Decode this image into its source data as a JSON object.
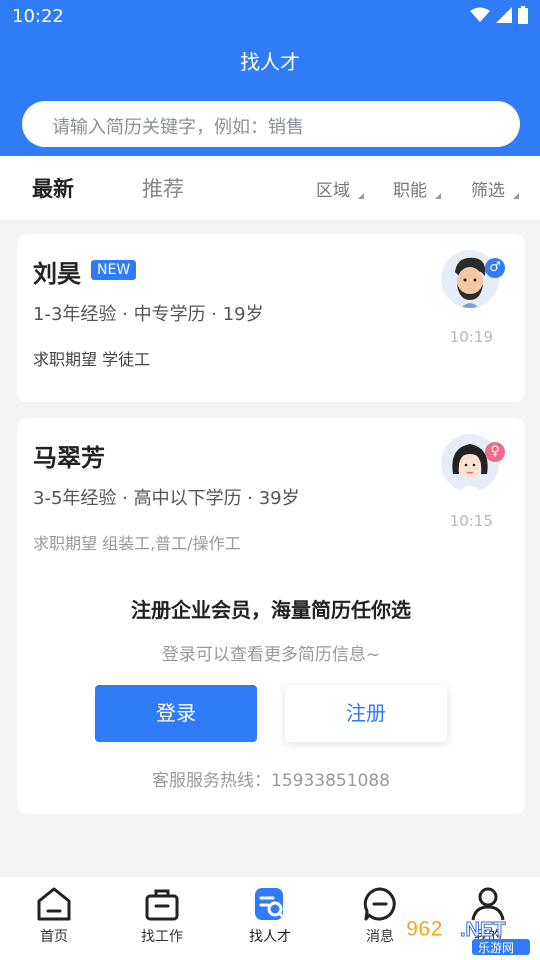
{
  "status": {
    "time": "10:22"
  },
  "header": {
    "title": "找人才"
  },
  "search": {
    "placeholder": "请输入简历关键字，例如：销售"
  },
  "tabs": {
    "latest": "最新",
    "recommend": "推荐"
  },
  "filters": {
    "area": "区域",
    "function": "职能",
    "filter": "筛选"
  },
  "cards": [
    {
      "name": "刘昊",
      "badge": "NEW",
      "info": "1-3年经验 · 中专学历 · 19岁",
      "expect": "求职期望 学徒工",
      "time": "10:19",
      "gender": "♂",
      "gender_color": "#2f7cf6"
    },
    {
      "name": "马翠芳",
      "info": "3-5年经验 · 高中以下学历 · 39岁",
      "expect": "求职期望 组装工,普工/操作工",
      "time": "10:15",
      "gender": "♀",
      "gender_color": "#f06b8c"
    }
  ],
  "promo": {
    "title": "注册企业会员，海量简历任你选",
    "subtitle": "登录可以查看更多简历信息~",
    "login": "登录",
    "register": "注册",
    "hotline": "客服服务热线：15933851088"
  },
  "nav": [
    {
      "label": "首页",
      "icon": "home-icon"
    },
    {
      "label": "找工作",
      "icon": "briefcase-icon"
    },
    {
      "label": "找人才",
      "icon": "talent-search-icon"
    },
    {
      "label": "消息",
      "icon": "message-icon"
    },
    {
      "label": "我的",
      "icon": "user-icon"
    }
  ],
  "watermark": {
    "text": "962.NET",
    "sub": "乐游网"
  },
  "colors": {
    "primary": "#2f7cf6",
    "background": "#f2f3f5"
  }
}
